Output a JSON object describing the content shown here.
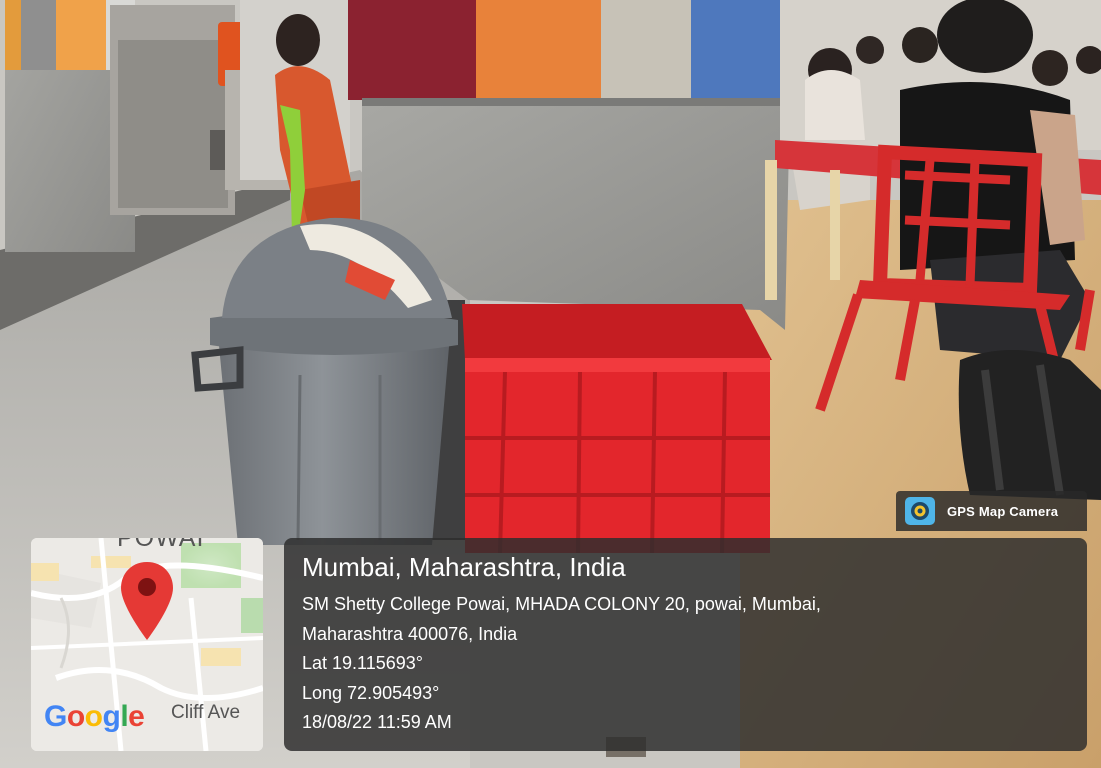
{
  "overlay": {
    "app_badge": "GPS Map Camera",
    "map": {
      "area_label": "POWAI",
      "street_label": "Cliff Ave",
      "logo_text": "Google",
      "logo_colors": [
        "#4285F4",
        "#EA4335",
        "#FBBC05",
        "#4285F4",
        "#34A853",
        "#EA4335"
      ],
      "pin_color": "#E53935"
    },
    "location_title": "Mumbai, Maharashtra, India",
    "address_line_1": "SM Shetty College Powai, MHADA COLONY 20, powai, Mumbai,",
    "address_line_2": "Maharashtra 400076, India",
    "latitude": "Lat 19.115693°",
    "longitude": "Long 72.905493°",
    "timestamp": "18/08/22 11:59 AM"
  },
  "scene": {
    "description_icons": [
      "dustbin-icon",
      "red-crate-icon",
      "red-chair-icon",
      "backpack-icon",
      "pillar-icon"
    ],
    "colors": {
      "dustbin": "#7d8287",
      "crate": "#e3262c",
      "chair": "#d52b2b",
      "pillar_granite": "#9d9d9a",
      "pillar_band": [
        "#8b2230",
        "#e8823a",
        "#c7c2b7",
        "#4e78bd"
      ],
      "floor_left": "#b9b7b1",
      "floor_right": "#d9b685"
    }
  }
}
